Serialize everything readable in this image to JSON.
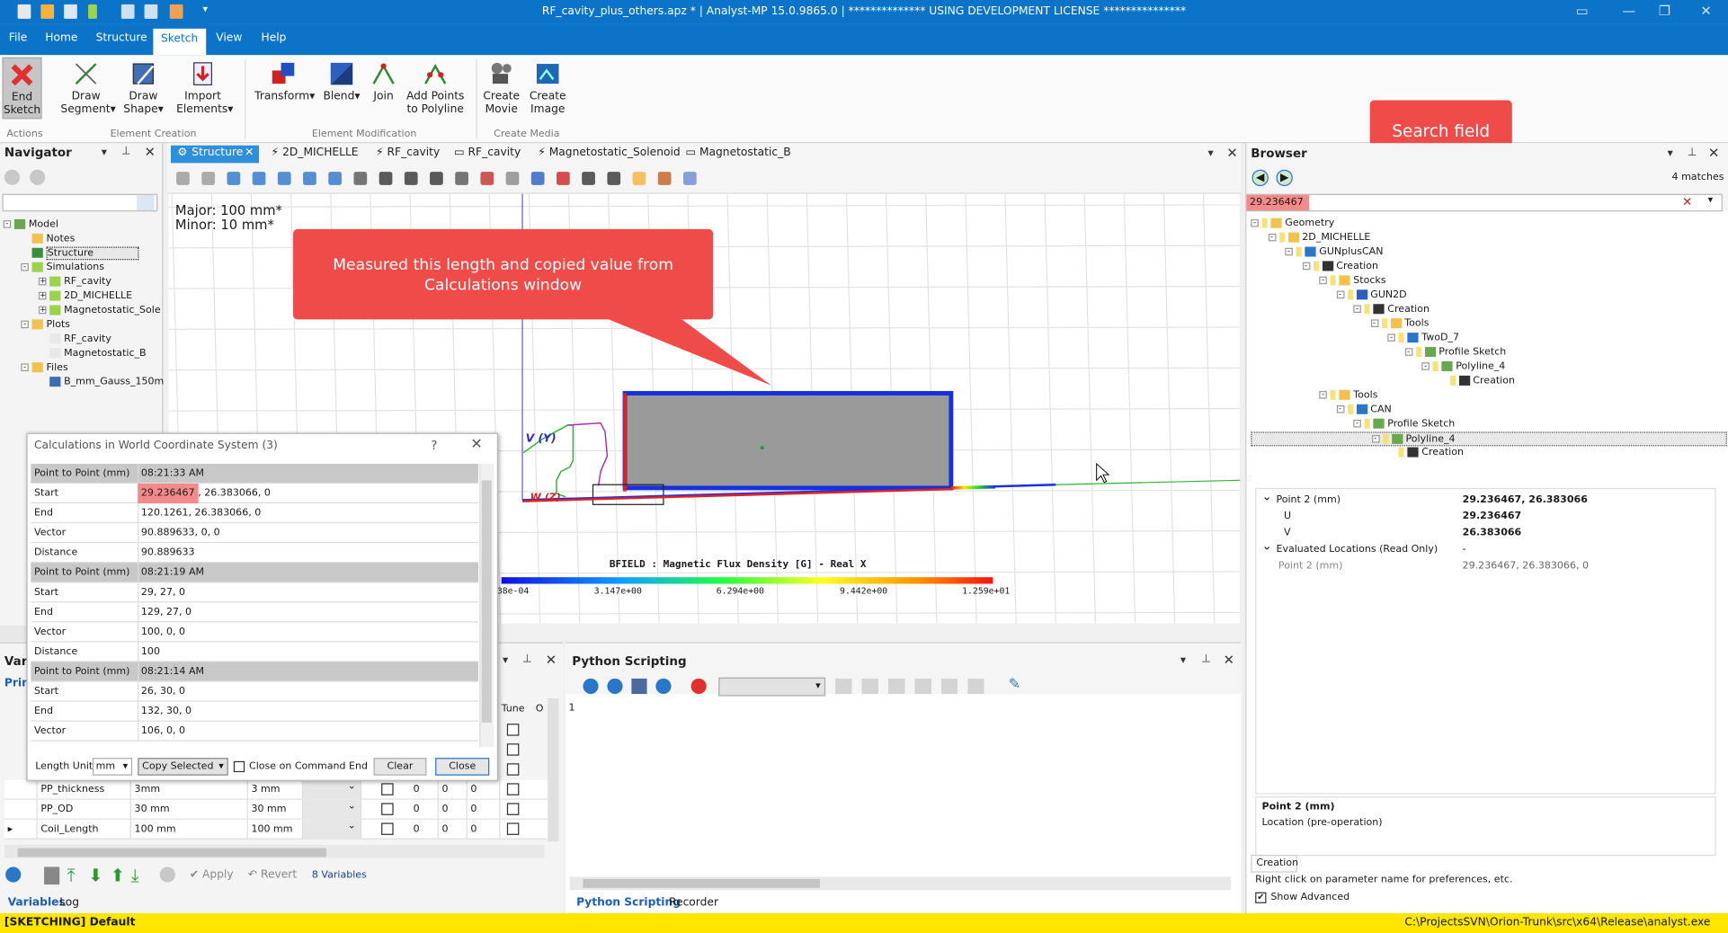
{
  "window": {
    "title": "RF_cavity_plus_others.apz * | Analyst-MP 15.0.9865.0 | ************** USING DEVELOPMENT LICENSE ***************"
  },
  "menu_tabs": [
    "File",
    "Home",
    "Structure",
    "Sketch",
    "View",
    "Help"
  ],
  "ribbon": {
    "end_sketch": [
      "End",
      "Sketch"
    ],
    "draw_segment": [
      "Draw",
      "Segment"
    ],
    "draw_shape": [
      "Draw",
      "Shape"
    ],
    "import_elements": [
      "Import",
      "Elements"
    ],
    "transform": "Transform",
    "blend": "Blend",
    "join": "Join",
    "add_points": [
      "Add Points",
      "to Polyline"
    ],
    "create_movie": [
      "Create",
      "Movie"
    ],
    "create_image": [
      "Create",
      "Image"
    ],
    "groups": [
      "Actions",
      "Element Creation",
      "Element Modification",
      "Create Media"
    ]
  },
  "navigator": {
    "title": "Navigator",
    "tree": [
      {
        "label": "Model",
        "level": 0,
        "box": "-"
      },
      {
        "label": "Notes",
        "level": 1,
        "box": ""
      },
      {
        "label": "Structure",
        "level": 1,
        "box": "",
        "selected": true
      },
      {
        "label": "Simulations",
        "level": 1,
        "box": "-"
      },
      {
        "label": "RF_cavity",
        "level": 2,
        "box": "+"
      },
      {
        "label": "2D_MICHELLE",
        "level": 2,
        "box": "+"
      },
      {
        "label": "Magnetostatic_Sole",
        "level": 2,
        "box": "+"
      },
      {
        "label": "Plots",
        "level": 1,
        "box": "-"
      },
      {
        "label": "RF_cavity",
        "level": 2,
        "box": ""
      },
      {
        "label": "Magnetostatic_B",
        "level": 2,
        "box": ""
      },
      {
        "label": "Files",
        "level": 1,
        "box": "-"
      },
      {
        "label": "B_mm_Gauss_150m",
        "level": 2,
        "box": ""
      }
    ]
  },
  "doc_tabs": [
    "Structure",
    "2D_MICHELLE",
    "RF_cavity",
    "RF_cavity",
    "Magnetostatic_Solenoid",
    "Magnetostatic_B"
  ],
  "canvas": {
    "major": "Major: 100 mm*",
    "minor": "Minor: 10 mm*",
    "axis_v": "V (Y)",
    "axis_w": "W (Z)",
    "colorbar_title": "BFIELD : Magnetic Flux Density [G] - Real X",
    "colorbar_ticks": [
      "38e-04",
      "3.147e+00",
      "6.294e+00",
      "9.442e+00",
      "1.259e+01"
    ],
    "callout": "Measured this length and copied value from Calculations window"
  },
  "search_callout": "Search field",
  "calc": {
    "title": "Calculations in World Coordinate System (3)",
    "help": "?",
    "rows": [
      {
        "k": "Point to Point (mm)",
        "v": "08:21:33 AM",
        "hdr": true
      },
      {
        "k": "Start",
        "v": "29.236467",
        "v2": ", 26.383066, 0",
        "hl": true
      },
      {
        "k": "End",
        "v": "120.1261, 26.383066, 0"
      },
      {
        "k": "Vector",
        "v": "90.889633, 0, 0"
      },
      {
        "k": "Distance",
        "v": "90.889633"
      },
      {
        "k": "Point to Point (mm)",
        "v": "08:21:19 AM",
        "hdr": true
      },
      {
        "k": "Start",
        "v": "29, 27, 0"
      },
      {
        "k": "End",
        "v": "129, 27, 0"
      },
      {
        "k": "Vector",
        "v": "100, 0, 0"
      },
      {
        "k": "Distance",
        "v": "100"
      },
      {
        "k": "Point to Point (mm)",
        "v": "08:21:14 AM",
        "hdr": true
      },
      {
        "k": "Start",
        "v": "26, 30, 0"
      },
      {
        "k": "End",
        "v": "132, 30, 0"
      },
      {
        "k": "Vector",
        "v": "106, 0, 0"
      }
    ],
    "length_unit_label": "Length Unit",
    "length_unit": "mm",
    "copy_selected": "Copy Selected",
    "close_on_cmd": "Close on Command End",
    "clear": "Clear",
    "close": "Close"
  },
  "variables": {
    "tab_label": "Vari",
    "prim_label": "Prim",
    "col_tune": "Tune",
    "col_o": "O",
    "rows": [
      {
        "name": "PP_thickness",
        "val": "3mm",
        "eval": "3 mm"
      },
      {
        "name": "PP_OD",
        "val": "30 mm",
        "eval": "30 mm"
      },
      {
        "name": "Coil_Length",
        "val": "100 mm",
        "eval": "100 mm"
      }
    ],
    "apply": "Apply",
    "revert": "Revert",
    "count": "8 Variables",
    "bottom_tabs": [
      "Variables",
      "Log"
    ]
  },
  "python": {
    "title": "Python Scripting",
    "line": "1",
    "bottom_tabs": [
      "Python Scripting",
      "Recorder"
    ]
  },
  "browser": {
    "title": "Browser",
    "matches": "4 matches",
    "search_value": "29.236467",
    "tree": [
      {
        "label": "Geometry",
        "level": 0
      },
      {
        "label": "2D_MICHELLE",
        "level": 1
      },
      {
        "label": "GUNplusCAN",
        "level": 2
      },
      {
        "label": "Creation",
        "level": 3
      },
      {
        "label": "Stocks",
        "level": 4
      },
      {
        "label": "GUN2D",
        "level": 5
      },
      {
        "label": "Creation",
        "level": 6
      },
      {
        "label": "Tools",
        "level": 7
      },
      {
        "label": "TwoD_7",
        "level": 8
      },
      {
        "label": "Profile Sketch",
        "level": 9
      },
      {
        "label": "Polyline_4",
        "level": 10
      },
      {
        "label": "Creation",
        "level": 11
      },
      {
        "label": "Tools",
        "level": 4
      },
      {
        "label": "CAN",
        "level": 5
      },
      {
        "label": "Profile Sketch",
        "level": 6
      },
      {
        "label": "Polyline_4",
        "level": 7,
        "selected": true
      },
      {
        "label": "Creation",
        "level": 8
      }
    ],
    "props": [
      {
        "k": "Point 2 (mm)",
        "v": "29.236467, 26.383066",
        "bold": true,
        "exp": true
      },
      {
        "k": "U",
        "v": "29.236467",
        "indent": true,
        "boldv": true
      },
      {
        "k": "V",
        "v": "26.383066",
        "indent": true,
        "boldv": true
      },
      {
        "k": "Evaluated Locations (Read Only)",
        "v": "-",
        "exp": true
      },
      {
        "k": "Point 2 (mm)",
        "v": "29.236467, 26.383066, 0",
        "indent": true,
        "grey": true
      }
    ],
    "desc_title": "Point 2 (mm)",
    "desc_text": "Location (pre-operation)",
    "creation_tab": "Creation",
    "hint": "Right click on parameter name for preferences, etc.",
    "show_advanced": "Show Advanced"
  },
  "status": {
    "left": "[SKETCHING] Default",
    "right": "C:\\ProjectsSVN\\Orion-Trunk\\src\\x64\\Release\\analyst.exe"
  }
}
